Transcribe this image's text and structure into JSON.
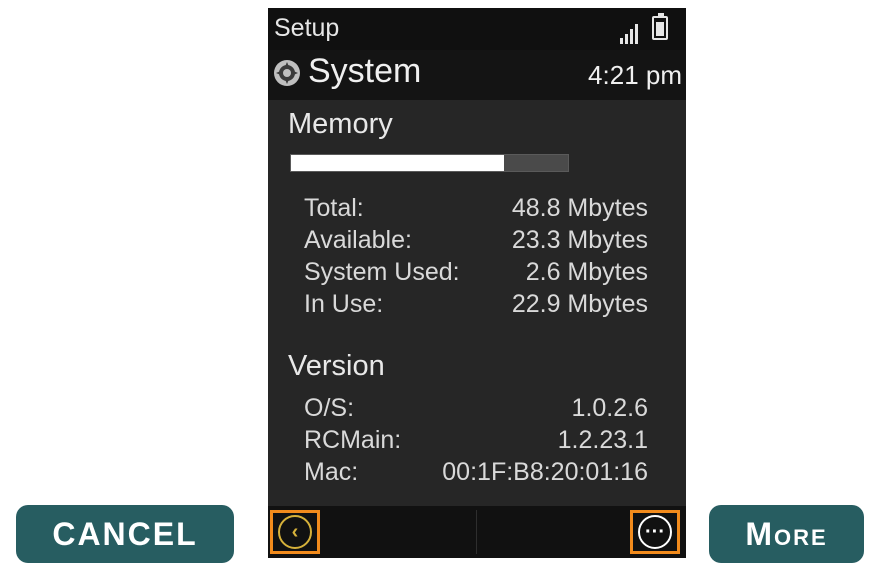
{
  "status_bar": {
    "title": "Setup",
    "signal_icon": "signal-bars-icon",
    "battery_icon": "battery-icon"
  },
  "header": {
    "icon": "system-gear-icon",
    "title": "System",
    "time": "4:21 pm"
  },
  "memory": {
    "heading": "Memory",
    "usage_fraction": 0.77,
    "rows": [
      {
        "label": "Total:",
        "value": "48.8 Mbytes"
      },
      {
        "label": "Available:",
        "value": "23.3 Mbytes"
      },
      {
        "label": "System Used:",
        "value": "2.6 Mbytes"
      },
      {
        "label": "In Use:",
        "value": "22.9 Mbytes"
      }
    ]
  },
  "version": {
    "heading": "Version",
    "rows": [
      {
        "label": "O/S:",
        "value": "1.0.2.6"
      },
      {
        "label": "RCMain:",
        "value": "1.2.23.1"
      },
      {
        "label": "Mac:",
        "value": "00:1F:B8:20:01:16"
      }
    ]
  },
  "bottom_bar": {
    "back_icon": "chevron-left-icon",
    "back_glyph": "‹",
    "more_icon": "more-dots-icon",
    "more_glyph": "···"
  },
  "buttons": {
    "cancel": "CANCEL",
    "more": "More"
  },
  "colors": {
    "device_bg": "#262626",
    "button_bg": "#275d61",
    "highlight": "#f28b1c",
    "back_icon": "#d6b13a"
  }
}
